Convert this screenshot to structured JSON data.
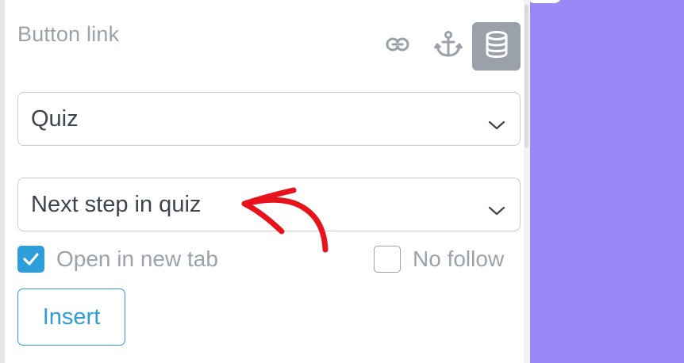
{
  "panel": {
    "title": "Button link",
    "icons": {
      "link": "link-icon",
      "anchor": "anchor-icon",
      "database": "database-icon"
    },
    "link_type_select": {
      "value": "Quiz"
    },
    "action_select": {
      "value": "Next step in quiz"
    },
    "open_new_tab": {
      "label": "Open in new tab",
      "checked": true
    },
    "no_follow": {
      "label": "No follow",
      "checked": false
    },
    "insert_label": "Insert"
  },
  "colors": {
    "accent": "#2d9ed9",
    "canvas": "#9b87f5",
    "annotation_arrow": "#e8141c",
    "muted_text": "#9aa2ab",
    "active_icon_bg": "#9aa1a9"
  }
}
